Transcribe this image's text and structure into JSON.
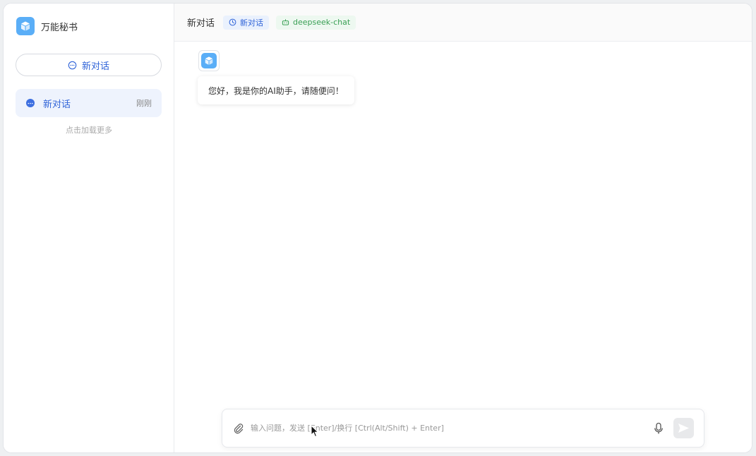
{
  "sidebar": {
    "brand_name": "万能秘书",
    "new_chat_label": "新对话",
    "conversations": [
      {
        "title": "新对话",
        "time": "刚刚"
      }
    ],
    "load_more": "点击加载更多"
  },
  "header": {
    "title": "新对话",
    "tags": [
      {
        "label": "新对话",
        "icon": "clock-icon"
      },
      {
        "label": "deepseek-chat",
        "icon": "robot-icon"
      }
    ]
  },
  "chat": {
    "messages": [
      {
        "role": "assistant",
        "text": "您好，我是你的AI助手，请随便问！"
      }
    ]
  },
  "composer": {
    "placeholder": "输入问题，发送 [Enter]/换行 [Ctrl(Alt/Shift) + Enter]"
  },
  "colors": {
    "accent": "#2f63d8",
    "logo": "#5aaef7",
    "green": "#3aa055"
  }
}
